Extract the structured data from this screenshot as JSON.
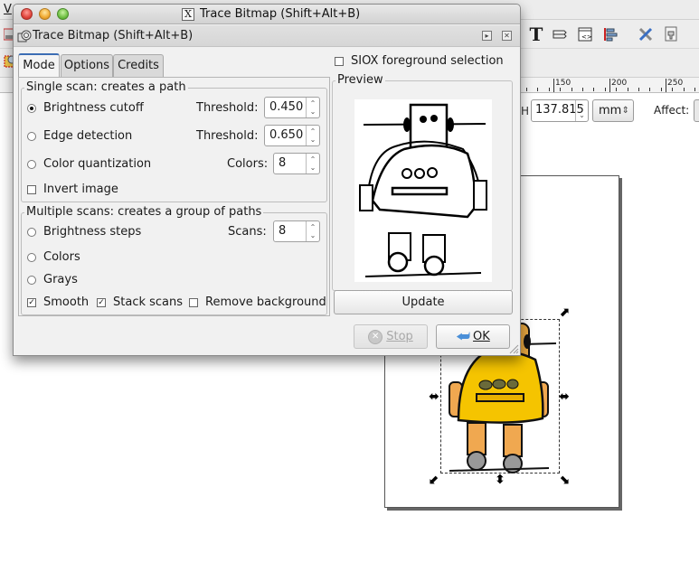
{
  "app": {
    "menu_first_letter": "V",
    "dimension_label": "H",
    "height_value": "137.815",
    "unit": "mm",
    "affect_label": "Affect:",
    "ruler_labels": [
      "150",
      "200",
      "250"
    ],
    "toolbar_icons": [
      "text-tool-icon",
      "layers-icon",
      "xml-editor-icon",
      "align-distribute-icon",
      "preferences-icon",
      "document-properties-icon"
    ]
  },
  "dialog": {
    "window_title": "Trace Bitmap (Shift+Alt+B)",
    "dock_title": "Trace Bitmap (Shift+Alt+B)",
    "tabs": [
      {
        "label": "Mode",
        "active": true
      },
      {
        "label": "Options",
        "active": false
      },
      {
        "label": "Credits",
        "active": false
      }
    ],
    "single_scan": {
      "legend": "Single scan: creates a path",
      "options": [
        {
          "label": "Brightness cutoff",
          "selected": true,
          "field_label": "Threshold:",
          "value": "0.450"
        },
        {
          "label": "Edge detection",
          "selected": false,
          "field_label": "Threshold:",
          "value": "0.650"
        },
        {
          "label": "Color quantization",
          "selected": false,
          "field_label": "Colors:",
          "value": "8"
        }
      ],
      "invert_image": {
        "label": "Invert image",
        "checked": false
      }
    },
    "multiple_scans": {
      "legend": "Multiple scans: creates a group of paths",
      "options": [
        {
          "label": "Brightness steps",
          "selected": false
        },
        {
          "label": "Colors",
          "selected": false
        },
        {
          "label": "Grays",
          "selected": false
        }
      ],
      "scans_label": "Scans:",
      "scans_value": "8",
      "smooth": {
        "label": "Smooth",
        "checked": true
      },
      "stack_scans": {
        "label": "Stack scans",
        "checked": true
      },
      "remove_background": {
        "label": "Remove background",
        "checked": false
      }
    },
    "siox": {
      "label": "SIOX foreground selection",
      "checked": false
    },
    "preview": {
      "legend": "Preview"
    },
    "update_button": "Update",
    "stop_button": "Stop",
    "ok_button": "OK"
  },
  "colors": {
    "robot_body": "#f5c400",
    "robot_limbs": "#f0a850",
    "tab_accent": "#3c6db4"
  }
}
